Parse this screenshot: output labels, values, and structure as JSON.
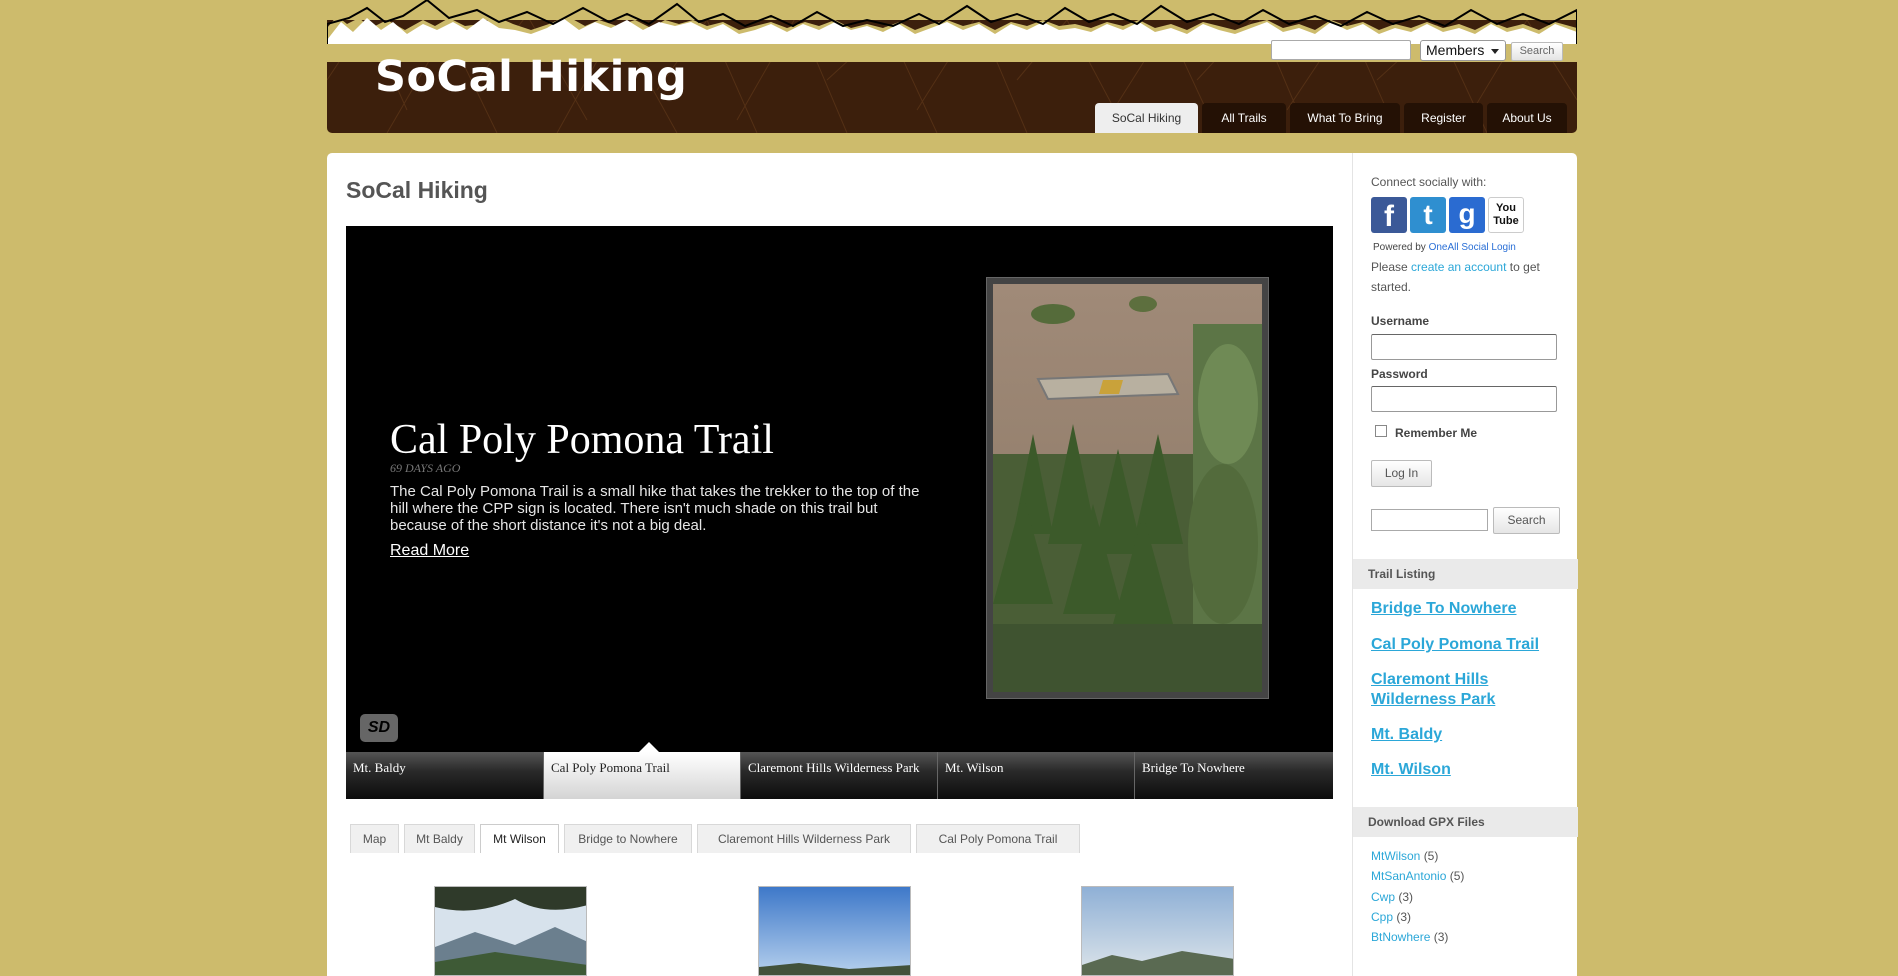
{
  "header": {
    "site_title": "SoCal Hiking",
    "members_select": "Members",
    "search_button": "Search",
    "nav": [
      {
        "label": "SoCal Hiking",
        "active": true
      },
      {
        "label": "All Trails",
        "active": false
      },
      {
        "label": "What To Bring",
        "active": false
      },
      {
        "label": "Register",
        "active": false
      },
      {
        "label": "About Us",
        "active": false
      }
    ]
  },
  "main": {
    "page_title": "SoCal Hiking",
    "slide": {
      "title": "Cal Poly Pomona Trail",
      "date": "69 DAYS AGO",
      "description": "The Cal Poly Pomona Trail is a small hike that takes the trekker to the top of the hill where the CPP sign is located. There isn't much shade on this trail but because of the short distance it's not a big deal.",
      "read_more": "Read More",
      "badge": "SD"
    },
    "slider_tabs": [
      {
        "label": "Mt. Baldy",
        "active": false
      },
      {
        "label": "Cal Poly Pomona Trail",
        "active": true
      },
      {
        "label": "Claremont Hills Wilderness Park",
        "active": false
      },
      {
        "label": "Mt. Wilson",
        "active": false
      },
      {
        "label": "Bridge To Nowhere",
        "active": false
      }
    ],
    "gallery_tabs": [
      {
        "label": "Map",
        "active": false
      },
      {
        "label": "Mt Baldy",
        "active": false
      },
      {
        "label": "Mt Wilson",
        "active": true
      },
      {
        "label": "Bridge to Nowhere",
        "active": false
      },
      {
        "label": "Claremont Hills Wilderness Park",
        "active": false
      },
      {
        "label": "Cal Poly Pomona Trail",
        "active": false
      }
    ]
  },
  "sidebar": {
    "connect_label": "Connect socially with:",
    "social": [
      {
        "icon": "facebook-icon",
        "glyph": "f",
        "color": "#3b5998"
      },
      {
        "icon": "twitter-icon",
        "glyph": "t",
        "color": "#2f8fd0"
      },
      {
        "icon": "google-icon",
        "glyph": "g",
        "color": "#2a6bd1"
      },
      {
        "icon": "youtube-icon",
        "glyph": "You Tube",
        "color": "#d92b2b"
      }
    ],
    "powered_by": "Powered by",
    "powered_link": "OneAll Social Login",
    "please_prefix": "Please",
    "please_link": "create an account",
    "please_suffix": "to get started.",
    "username_label": "Username",
    "password_label": "Password",
    "remember_label": "Remember Me",
    "login_button": "Log In",
    "search_button": "Search",
    "trail_listing_title": "Trail Listing",
    "trails": [
      "Bridge To Nowhere",
      "Cal Poly Pomona Trail",
      "Claremont Hills Wilderness Park",
      "Mt. Baldy",
      "Mt. Wilson"
    ],
    "gpx_title": "Download GPX Files",
    "gpx": [
      {
        "name": "MtWilson",
        "count": "(5)"
      },
      {
        "name": "MtSanAntonio",
        "count": "(5)"
      },
      {
        "name": "Cwp",
        "count": "(3)"
      },
      {
        "name": "Cpp",
        "count": "(3)"
      },
      {
        "name": "BtNowhere",
        "count": "(3)"
      }
    ]
  }
}
